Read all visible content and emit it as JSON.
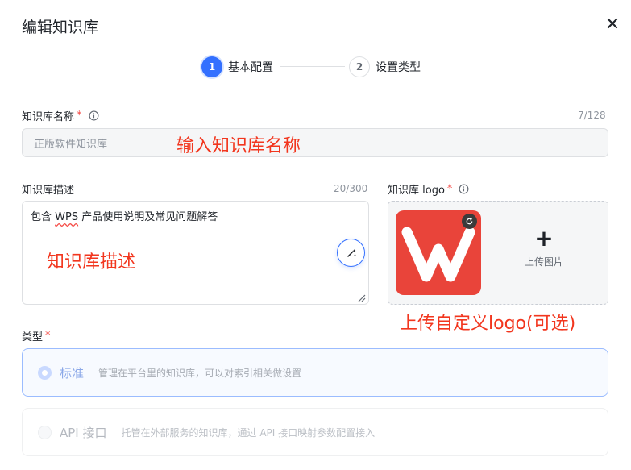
{
  "dialog": {
    "title": "编辑知识库",
    "close_icon": "close-icon"
  },
  "steps": [
    {
      "number": "1",
      "label": "基本配置",
      "active": true
    },
    {
      "number": "2",
      "label": "设置类型",
      "active": false
    }
  ],
  "name_field": {
    "label": "知识库名称",
    "required_mark": "*",
    "counter": "7/128",
    "value": "正版软件知识库"
  },
  "desc_field": {
    "label": "知识库描述",
    "counter": "20/300",
    "value_prefix": "包含 ",
    "value_highlight": "WPS",
    "value_suffix": " 产品使用说明及常见问题解答"
  },
  "logo_field": {
    "label": "知识库 logo",
    "required_mark": "*",
    "upload_label": "上传图片",
    "upload_icon": "+"
  },
  "type_field": {
    "label": "类型",
    "required_mark": "*",
    "options": [
      {
        "name": "标准",
        "desc": "管理在平台里的知识库，可以对索引相关做设置",
        "selected": true
      },
      {
        "name": "API 接口",
        "desc": "托管在外部服务的知识库，通过 API 接口映射参数配置接入",
        "selected": false
      }
    ]
  },
  "annotations": {
    "name": "输入知识库名称",
    "desc": "知识库描述",
    "logo": "上传自定义logo(可选)"
  },
  "colors": {
    "accent": "#3370ff",
    "annotation": "#f2361e",
    "logo_bg": "#e9443a"
  }
}
